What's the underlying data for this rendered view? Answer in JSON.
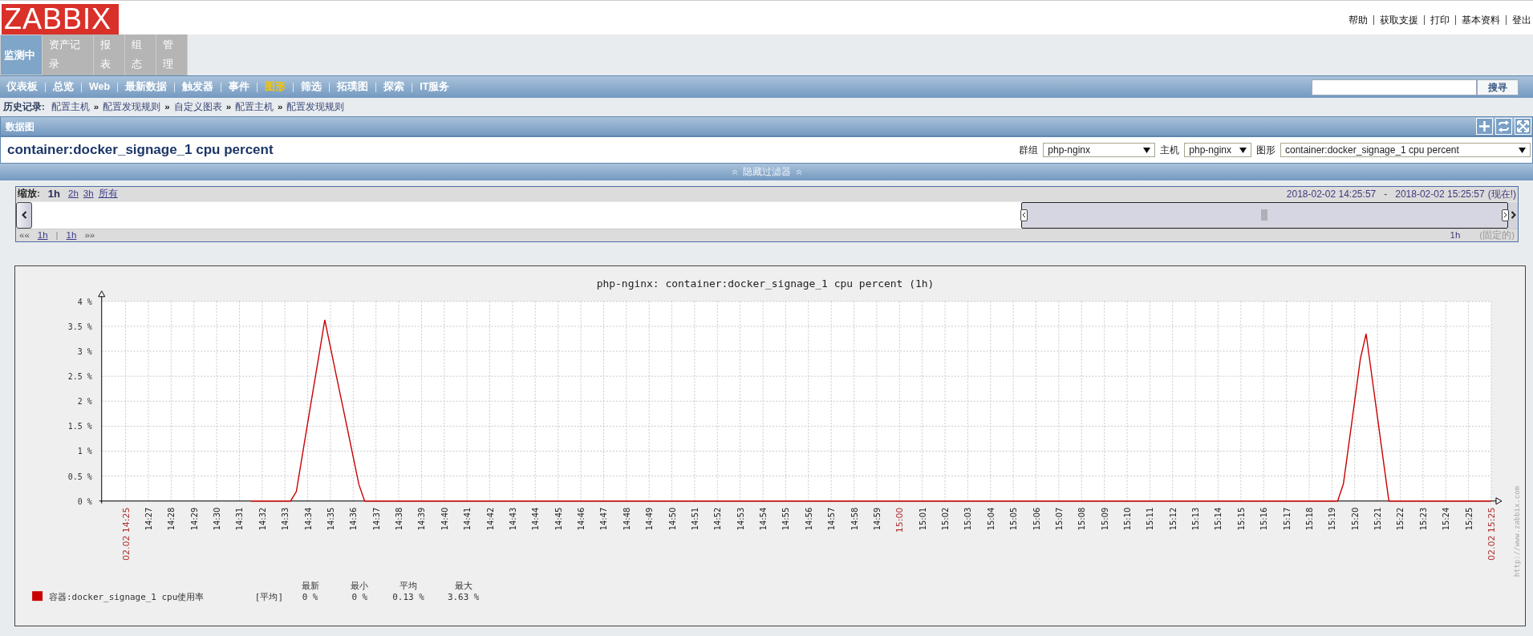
{
  "logo": "ZABBIX",
  "top_links": [
    "帮助",
    "获取支援",
    "打印",
    "基本资料",
    "登出"
  ],
  "main_tabs": [
    {
      "label": "监测中",
      "selected": true
    },
    {
      "label": "资产记录",
      "selected": false
    },
    {
      "label": "报表",
      "selected": false
    },
    {
      "label": "组态",
      "selected": false
    },
    {
      "label": "管理",
      "selected": false
    }
  ],
  "nav": [
    {
      "label": "仪表板",
      "selected": false
    },
    {
      "label": "总览",
      "selected": false
    },
    {
      "label": "Web",
      "selected": false
    },
    {
      "label": "最新数据",
      "selected": false
    },
    {
      "label": "触发器",
      "selected": false
    },
    {
      "label": "事件",
      "selected": false
    },
    {
      "label": "图形",
      "selected": true
    },
    {
      "label": "筛选",
      "selected": false
    },
    {
      "label": "拓璞图",
      "selected": false
    },
    {
      "label": "探索",
      "selected": false
    },
    {
      "label": "IT服务",
      "selected": false
    }
  ],
  "search": {
    "button": "搜寻"
  },
  "history": {
    "label": "历史记录:",
    "separator": "»",
    "items": [
      "配置主机",
      "配置发现规则",
      "自定义图表",
      "配置主机",
      "配置发现规则"
    ]
  },
  "section_title": "数据图",
  "graph_title": "container:docker_signage_1 cpu percent",
  "filters": [
    {
      "label": "群组",
      "value": "php-nginx"
    },
    {
      "label": "主机",
      "value": "php-nginx"
    },
    {
      "label": "图形",
      "value": "container:docker_signage_1 cpu percent"
    }
  ],
  "filter_toggle": "隐藏过滤器",
  "timeline": {
    "zoom_label": "缩放:",
    "zoom_options": [
      {
        "label": "1h",
        "selected": true
      },
      {
        "label": "2h",
        "selected": false
      },
      {
        "label": "3h",
        "selected": false
      },
      {
        "label": "所有",
        "selected": false
      }
    ],
    "period_start": "2018-02-02 14:25:57",
    "period_sep": "-",
    "period_end": "2018-02-02 15:25:57",
    "now": "(现在!)",
    "back": "««",
    "step_back": "1h",
    "step_sep": "|",
    "step_forward": "1h",
    "forward": "»»",
    "duration": "1h",
    "fixed": "(固定的)",
    "slider": {
      "level": 0.33
    }
  },
  "chart": {
    "side_text": "http://www.zabbix.com",
    "chart_data": {
      "type": "line",
      "title": "php-nginx: container:docker_signage_1 cpu percent (1h)",
      "categories": [
        "02.02 14:25",
        null,
        null,
        null,
        "14:27",
        null,
        null,
        null,
        "14:28",
        null,
        null,
        null,
        "14:29",
        null,
        null,
        null,
        "14:30",
        null,
        null,
        null,
        "14:31",
        null,
        null,
        null,
        "14:32",
        null,
        null,
        null,
        "14:33",
        null,
        null,
        null,
        "14:34",
        null,
        null,
        null,
        "14:35",
        null,
        null,
        null,
        "14:36",
        null,
        null,
        null,
        "14:37",
        null,
        null,
        null,
        "14:38",
        null,
        null,
        null,
        "14:39",
        null,
        null,
        null,
        "14:40",
        null,
        null,
        null,
        "14:41",
        null,
        null,
        null,
        "14:42",
        null,
        null,
        null,
        "14:43",
        null,
        null,
        null,
        "14:44",
        null,
        null,
        null,
        "14:45",
        null,
        null,
        null,
        "14:46",
        null,
        null,
        null,
        "14:47",
        null,
        null,
        null,
        "14:48",
        null,
        null,
        null,
        "14:49",
        null,
        null,
        null,
        "14:50",
        null,
        null,
        null,
        "14:51",
        null,
        null,
        null,
        "14:52",
        null,
        null,
        null,
        "14:53",
        null,
        null,
        null,
        "14:54",
        null,
        null,
        null,
        "14:55",
        null,
        null,
        null,
        "14:56",
        null,
        null,
        null,
        "14:57",
        null,
        null,
        null,
        "14:58",
        null,
        null,
        null,
        "14:59",
        null,
        null,
        null,
        "15:00",
        null,
        null,
        null,
        "15:01",
        null,
        null,
        null,
        "15:02",
        null,
        null,
        null,
        "15:03",
        null,
        null,
        null,
        "15:04",
        null,
        null,
        null,
        "15:05",
        null,
        null,
        null,
        "15:06",
        null,
        null,
        null,
        "15:07",
        null,
        null,
        null,
        "15:08",
        null,
        null,
        null,
        "15:09",
        null,
        null,
        null,
        "15:10",
        null,
        null,
        null,
        "15:11",
        null,
        null,
        null,
        "15:12",
        null,
        null,
        null,
        "15:13",
        null,
        null,
        null,
        "15:14",
        null,
        null,
        null,
        "15:15",
        null,
        null,
        null,
        "15:16",
        null,
        null,
        null,
        "15:17",
        null,
        null,
        null,
        "15:18",
        null,
        null,
        null,
        "15:19",
        null,
        null,
        null,
        "15:20",
        null,
        null,
        null,
        "15:21",
        null,
        null,
        null,
        "15:22",
        null,
        null,
        null,
        "15:23",
        null,
        null,
        null,
        "15:24",
        null,
        null,
        null,
        "15:25",
        null,
        null,
        null,
        "02.02 15:25"
      ],
      "series": [
        {
          "name": "容器:docker_signage_1 cpu使用率",
          "color": "#c80000",
          "values": [
            null,
            null,
            null,
            null,
            null,
            null,
            null,
            null,
            null,
            null,
            null,
            null,
            null,
            null,
            null,
            null,
            null,
            null,
            null,
            null,
            null,
            null,
            0,
            0,
            0,
            0,
            0,
            0,
            0,
            0,
            0.19,
            0.88,
            1.57,
            2.25,
            2.94,
            3.63,
            3.08,
            2.53,
            1.98,
            1.43,
            0.88,
            0.33,
            0,
            0,
            0,
            0,
            0,
            0,
            0,
            0,
            0,
            0,
            0,
            0,
            0,
            0,
            0,
            0,
            0,
            0,
            0,
            0,
            0,
            0,
            0,
            0,
            0,
            0,
            0,
            0,
            0,
            0,
            0,
            0,
            0,
            0,
            0,
            0,
            0,
            0,
            0,
            0,
            0,
            0,
            0,
            0,
            0,
            0,
            0,
            0,
            0,
            0,
            0,
            0,
            0,
            0,
            0,
            0,
            0,
            0,
            0,
            0,
            0,
            0,
            0,
            0,
            0,
            0,
            0,
            0,
            0,
            0,
            0,
            0,
            0,
            0,
            0,
            0,
            0,
            0,
            0,
            0,
            0,
            0,
            0,
            0,
            0,
            0,
            0,
            0,
            0,
            0,
            0,
            0,
            0,
            0,
            0,
            0,
            0,
            0,
            0,
            0,
            0,
            0,
            0,
            0,
            0,
            0,
            0,
            0,
            0,
            0,
            0,
            0,
            0,
            0,
            0,
            0,
            0,
            0,
            0,
            0,
            0,
            0,
            0,
            0,
            0,
            0,
            0,
            0,
            0,
            0,
            0,
            0,
            0,
            0,
            0,
            0,
            0,
            0,
            0,
            0,
            0,
            0,
            0,
            0,
            0,
            0,
            0,
            0,
            0,
            0,
            0,
            0,
            0,
            0,
            0,
            0,
            0,
            0,
            0,
            0,
            0,
            0,
            0,
            0,
            0,
            0,
            0,
            0,
            0,
            0,
            0,
            0,
            0.34,
            1.17,
            2.01,
            2.85,
            3.35,
            2.51,
            1.68,
            0.84,
            0,
            0,
            0,
            0,
            0,
            0,
            0,
            0,
            0,
            0,
            0,
            0,
            0,
            0,
            0,
            0,
            0,
            0,
            0
          ]
        }
      ],
      "ylim": [
        0,
        4
      ],
      "grid": true,
      "yticks": [
        {
          "value": 0,
          "label": "0 %"
        },
        {
          "value": 0.5,
          "label": "0.5 %"
        },
        {
          "value": 1,
          "label": "1 %"
        },
        {
          "value": 1.5,
          "label": "1.5 %"
        },
        {
          "value": 2,
          "label": "2 %"
        },
        {
          "value": 2.5,
          "label": "2.5 %"
        },
        {
          "value": 3,
          "label": "3 %"
        },
        {
          "value": 3.5,
          "label": "3.5 %"
        },
        {
          "value": 4,
          "label": "4 %"
        }
      ]
    },
    "legend": {
      "headers": [
        "最新",
        "最小",
        "平均",
        "最大"
      ],
      "items": [
        {
          "function": "[平均]",
          "values": [
            "0 %",
            "0 %",
            "0.13 %",
            "3.63 %"
          ]
        }
      ]
    }
  }
}
